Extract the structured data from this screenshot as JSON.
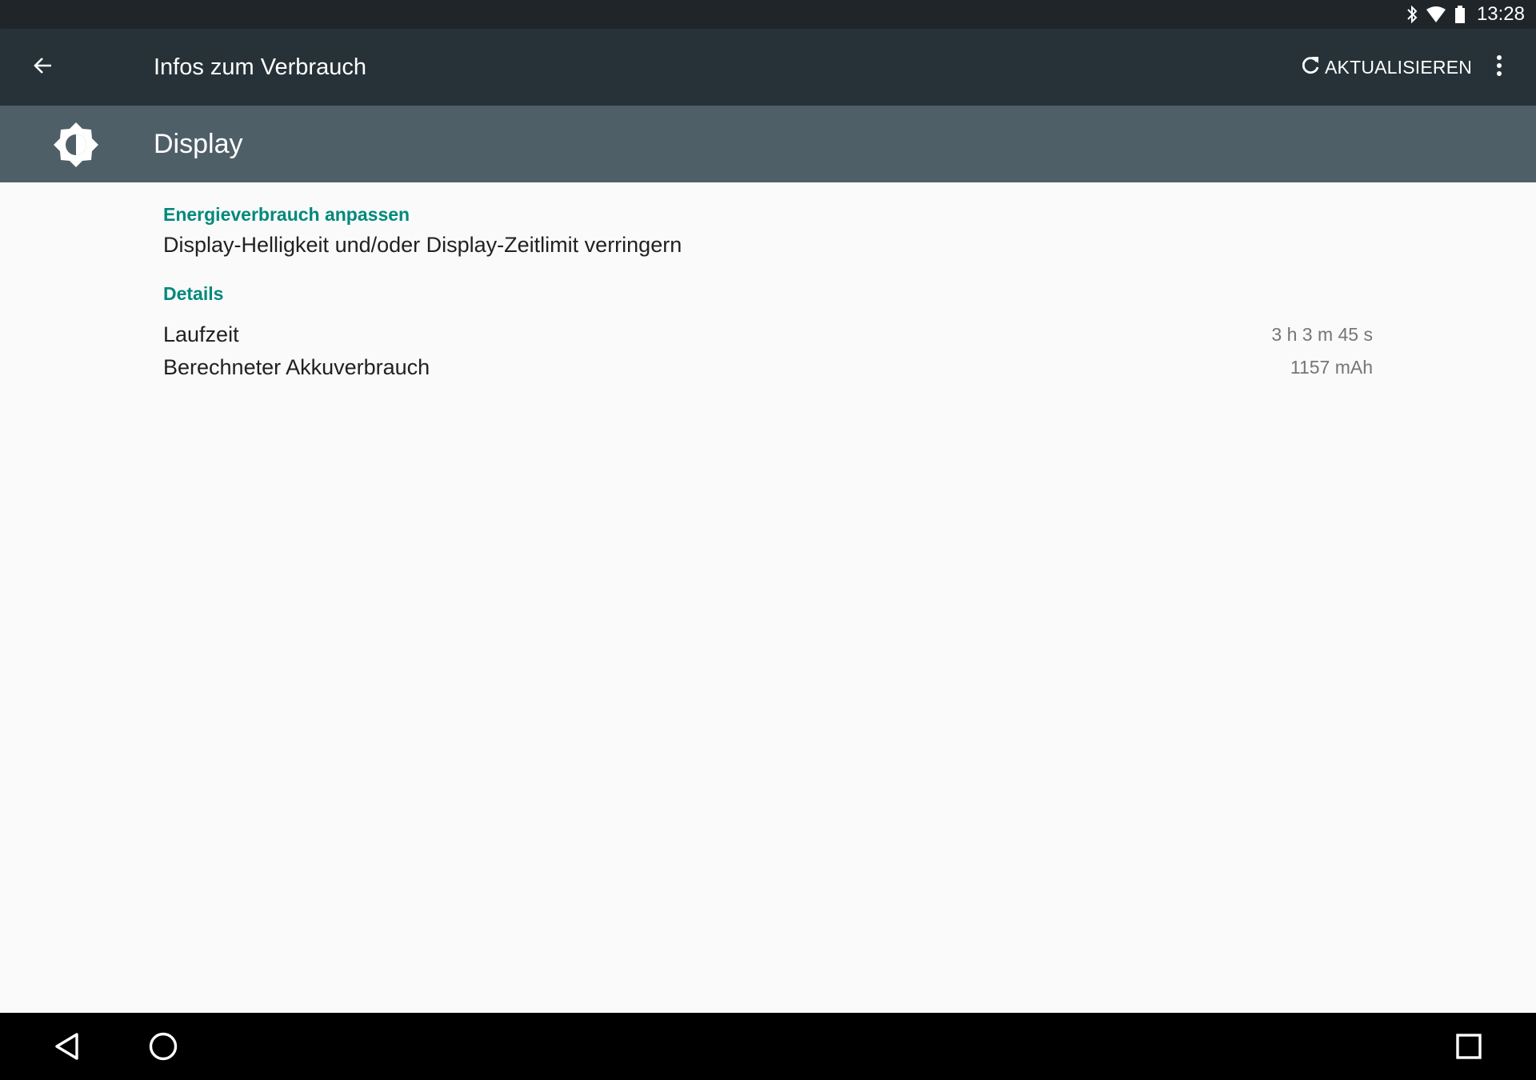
{
  "status_bar": {
    "icons": [
      "bluetooth-icon",
      "wifi-icon",
      "battery-icon"
    ],
    "time": "13:28"
  },
  "toolbar": {
    "title": "Infos zum Verbrauch",
    "refresh_label": "AKTUALISIEREN",
    "icons": [
      "back-arrow-icon",
      "refresh-icon",
      "more-vert-icon"
    ]
  },
  "header": {
    "title": "Display",
    "icon": "brightness-icon"
  },
  "content": {
    "tune_header": "Energieverbrauch anpassen",
    "tune_text": "Display-Helligkeit und/oder Display-Zeitlimit verringern",
    "details_header": "Details",
    "details": [
      {
        "label": "Laufzeit",
        "value": "3 h 3 m 45 s"
      },
      {
        "label": "Berechneter Akkuverbrauch",
        "value": "1157 mAh"
      }
    ]
  },
  "nav_bar": {
    "icons": [
      "nav-back-icon",
      "nav-home-icon",
      "nav-recents-icon"
    ]
  },
  "colors": {
    "status_bar": "#1f2529",
    "toolbar": "#263238",
    "header_band": "#4f5f67",
    "accent": "#00897b",
    "background": "#fafafa",
    "nav_bar": "#000000"
  }
}
